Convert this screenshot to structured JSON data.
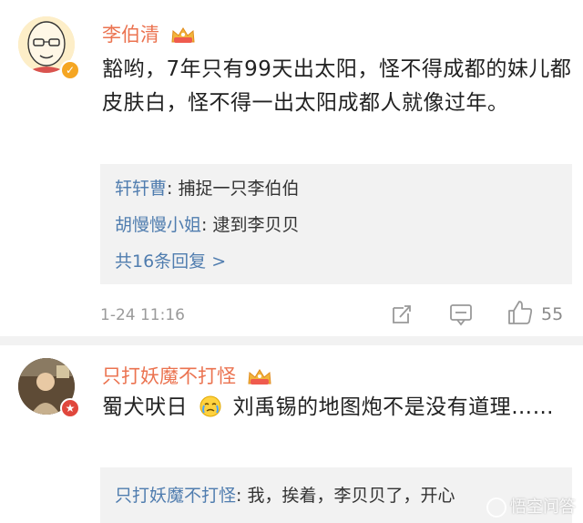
{
  "comments": [
    {
      "username": "李伯清",
      "text": "豁哟，7年只有99天出太阳，怪不得成都的妹儿都皮肤白，怪不得一出太阳成都人就像过年。",
      "replies": [
        {
          "name": "轩轩曹",
          "text": ": 捕捉一只李伯伯"
        },
        {
          "name": "胡慢慢小姐",
          "text": ": 逮到李贝贝"
        }
      ],
      "more_replies": "共16条回复 >",
      "timestamp": "1-24 11:16",
      "likes": "55"
    },
    {
      "username": "只打妖魔不打怪",
      "text_part1": "蜀犬吠日",
      "text_part2": "刘禹锡的地图炮不是没有道理……",
      "emoji": "crying-emoji",
      "replies": [
        {
          "name": "只打妖魔不打怪",
          "text": ": 我，挨着，李贝贝了，开心"
        }
      ]
    }
  ],
  "watermark": "悟空问答",
  "colors": {
    "username": "#eb7350",
    "link": "#507daf",
    "meta": "#9a9a9a",
    "reply_bg": "#f2f2f2"
  }
}
